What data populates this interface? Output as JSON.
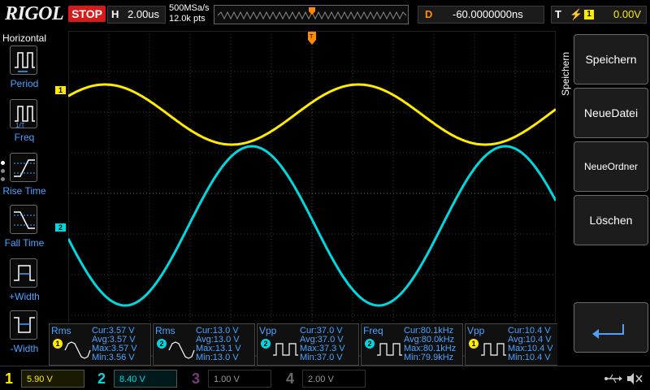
{
  "topbar": {
    "logo": "RIGOL",
    "run_state": "STOP",
    "timebase_key": "H",
    "timebase_value": "2.00us",
    "sample_rate": "500MSa/s",
    "memory_depth": "12.0k pts",
    "delay_key": "D",
    "delay_value": "-60.0000000ns",
    "trigger_key": "T",
    "trigger_edge_symbol": "⚡",
    "trigger_source": "1",
    "trigger_level": "0.00V"
  },
  "left_menu": {
    "title": "Horizontal",
    "items": [
      {
        "label": "Period",
        "icon": "period-measure-icon"
      },
      {
        "label": "Freq",
        "icon": "frequency-measure-icon"
      },
      {
        "label": "Rise Time",
        "icon": "rise-time-icon"
      },
      {
        "label": "Fall Time",
        "icon": "fall-time-icon"
      },
      {
        "label": "+Width",
        "icon": "positive-width-icon"
      },
      {
        "label": "-Width",
        "icon": "negative-width-icon"
      }
    ]
  },
  "channel_markers": {
    "ch1": "1",
    "ch2": "2"
  },
  "measurements": [
    {
      "name": "Rms",
      "channel": "1",
      "color": "#ffeb00",
      "cur": "Cur:3.57 V",
      "avg": "Avg:3.57 V",
      "max": "Max:3.57 V",
      "min": "Min:3.56 V"
    },
    {
      "name": "Rms",
      "channel": "2",
      "color": "#00d8e0",
      "cur": "Cur:13.0 V",
      "avg": "Avg:13.0 V",
      "max": "Max:13.1 V",
      "min": "Min:13.0 V"
    },
    {
      "name": "Vpp",
      "channel": "2",
      "color": "#00d8e0",
      "cur": "Cur:37.0 V",
      "avg": "Avg:37.0 V",
      "max": "Max:37.3 V",
      "min": "Min:37.0 V"
    },
    {
      "name": "Freq",
      "channel": "2",
      "color": "#00d8e0",
      "cur": "Cur:80.1kHz",
      "avg": "Avg:80.0kHz",
      "max": "Max:80.1kHz",
      "min": "Min:79.9kHz"
    },
    {
      "name": "Vpp",
      "channel": "1",
      "color": "#ffeb00",
      "cur": "Cur:10.4 V",
      "avg": "Avg:10.4 V",
      "max": "Max:10.4 V",
      "min": "Min:10.4 V"
    }
  ],
  "right_menu": {
    "title": "Speichern",
    "buttons": [
      "Speichern",
      "NeueDatei",
      "NeueOrdner",
      "Löschen"
    ],
    "enter_icon": "enter-arrow-icon"
  },
  "channels": [
    {
      "num": "1",
      "scale": "5.90 V",
      "color": "#ffeb00",
      "active": true
    },
    {
      "num": "2",
      "scale": "8.40 V",
      "color": "#00d8e0",
      "active": true
    },
    {
      "num": "3",
      "scale": "1.00 V",
      "color": "#7a3b7a",
      "active": false
    },
    {
      "num": "4",
      "scale": "2.00 V",
      "color": "#6a6a6a",
      "active": false
    }
  ],
  "status_icons": [
    "usb-icon",
    "mute-speaker-icon"
  ],
  "colors": {
    "ch1": "#ffeb00",
    "ch2": "#00d8e0",
    "menu_label": "#4aa3ff",
    "stop": "#d71a1a",
    "delay": "#ff8c00"
  }
}
